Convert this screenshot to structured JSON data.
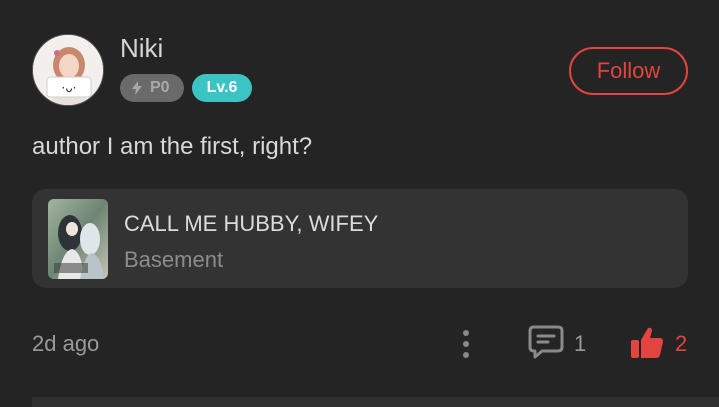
{
  "author": {
    "name": "Niki",
    "power_badge": "P0",
    "level_badge": "Lv.6",
    "follow_label": "Follow"
  },
  "post": {
    "text": "author I am the first, right?",
    "time": "2d ago"
  },
  "book": {
    "title": "CALL ME HUBBY, WIFEY",
    "subtitle": "Basement"
  },
  "stats": {
    "comments": "1",
    "likes": "2"
  },
  "colors": {
    "background": "#242424",
    "accent": "#e3443f",
    "level_badge": "#3cc3c4",
    "card": "#333333"
  },
  "icons": [
    "avatar",
    "bolt-icon",
    "more-vertical-icon",
    "comment-icon",
    "thumbs-up-icon"
  ]
}
